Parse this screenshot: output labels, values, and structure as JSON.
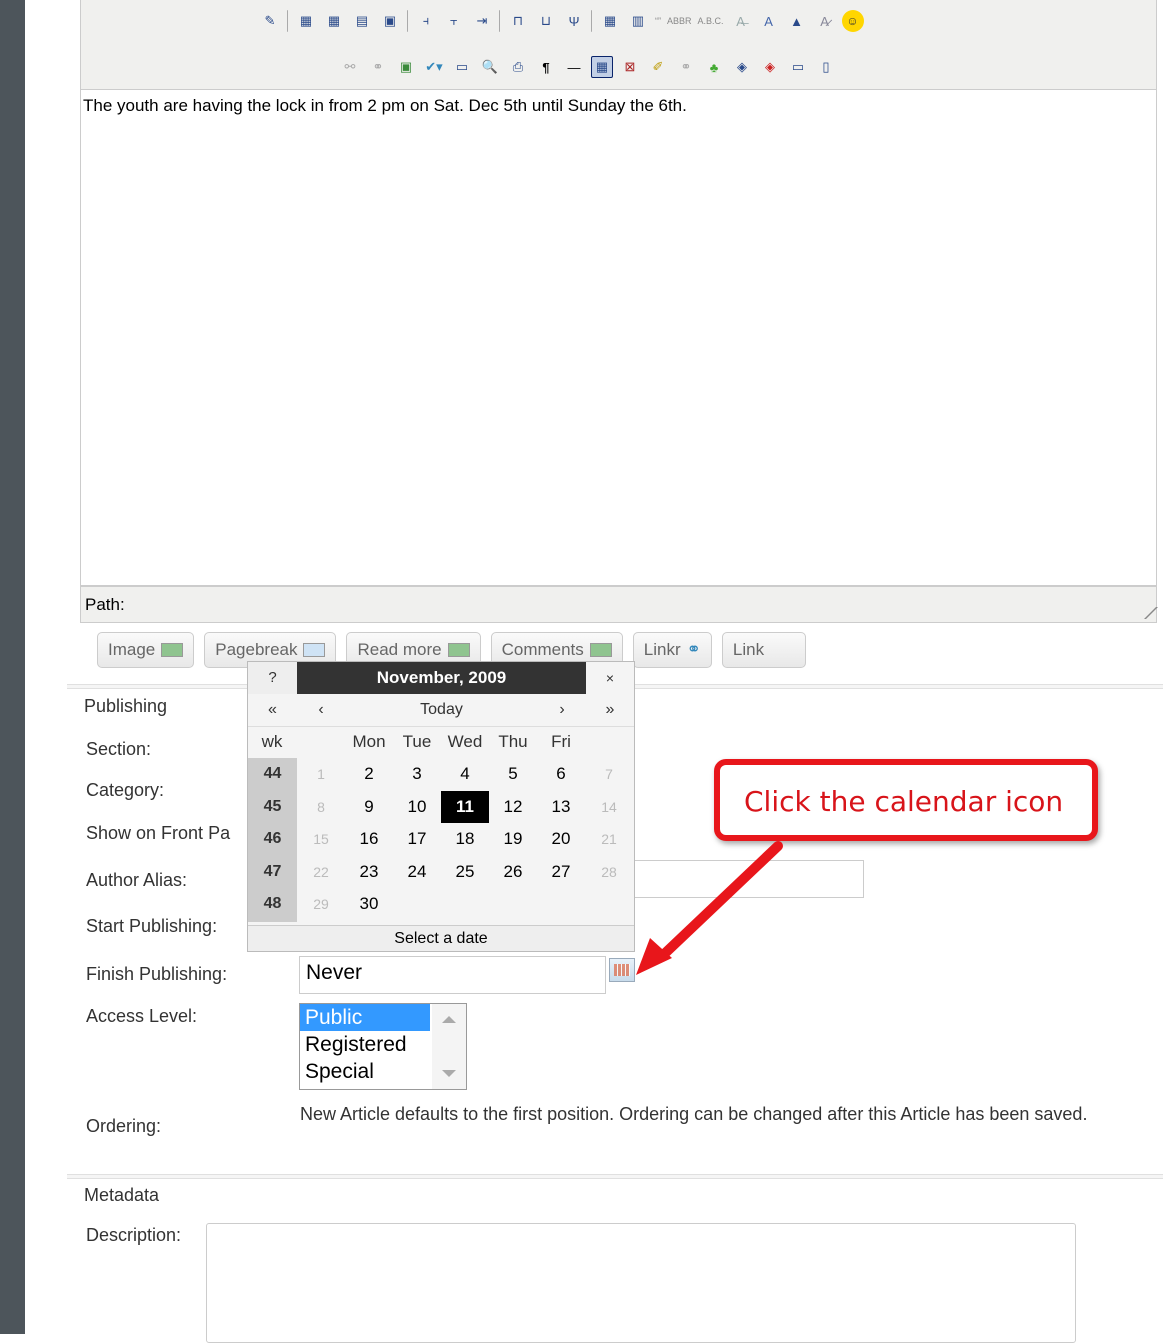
{
  "editor": {
    "content": "The youth are having the lock in from 2 pm on Sat. Dec 5th until Sunday the 6th.",
    "path_label": "Path:",
    "buttons": [
      "Image",
      "Pagebreak",
      "Read more",
      "Comments",
      "Linkr",
      "Link"
    ]
  },
  "publishing": {
    "legend": "Publishing",
    "labels": {
      "section": "Section:",
      "category": "Category:",
      "show_front": "Show on Front Pa",
      "author_alias": "Author Alias:",
      "start_publishing": "Start Publishing:",
      "finish_publishing": "Finish Publishing:",
      "access_level": "Access Level:",
      "ordering": "Ordering:"
    },
    "finish_value": "Never",
    "access_options": [
      "Public",
      "Registered",
      "Special"
    ],
    "access_selected": "Public",
    "ordering_text": "New Article defaults to the first position. Ordering can be changed after this Article has been saved."
  },
  "metadata": {
    "legend": "Metadata",
    "description_label": "Description:"
  },
  "calendar": {
    "help": "?",
    "title": "November, 2009",
    "close": "×",
    "prev_year": "«",
    "prev_month": "‹",
    "today": "Today",
    "next_month": "›",
    "next_year": "»",
    "wk_header": "wk",
    "day_headers": [
      "Mon",
      "Tue",
      "Wed",
      "Thu",
      "Fri"
    ],
    "weeks": [
      {
        "wk": "44",
        "days": [
          "1",
          "2",
          "3",
          "4",
          "5",
          "6",
          "7"
        ]
      },
      {
        "wk": "45",
        "days": [
          "8",
          "9",
          "10",
          "11",
          "12",
          "13",
          "14"
        ]
      },
      {
        "wk": "46",
        "days": [
          "15",
          "16",
          "17",
          "18",
          "19",
          "20",
          "21"
        ]
      },
      {
        "wk": "47",
        "days": [
          "22",
          "23",
          "24",
          "25",
          "26",
          "27",
          "28"
        ]
      },
      {
        "wk": "48",
        "days": [
          "29",
          "30"
        ]
      }
    ],
    "selected_day": "11",
    "footer": "Select a date"
  },
  "callout": {
    "text": "Click the calendar icon",
    "color": "#e8161b"
  },
  "toolbar_icons": {
    "row1": [
      "edit-icon",
      "sep",
      "insert-row-before-icon",
      "insert-row-after-icon",
      "delete-row-icon",
      "table-props-icon",
      "sep",
      "col-before-icon",
      "col-after-icon",
      "delete-col-icon",
      "sep",
      "split-cell-icon",
      "merge-cell-icon",
      "sep",
      "table-icon",
      "table-row-icon",
      "cite-icon",
      "abbr-icon",
      "acronym-icon",
      "strikethrough-icon",
      "underline-color-icon",
      "attributes-icon",
      "style-icon",
      "smiley-icon"
    ],
    "row2": [
      "unlink-icon",
      "link-icon",
      "image-icon",
      "spellcheck-icon",
      "media-icon",
      "preview-icon",
      "print-icon",
      "pilcrow-icon",
      "hr-icon",
      "visual-aid-icon",
      "template-icon",
      "cleanup-icon",
      "anchor-icon",
      "tree-icon",
      "code-icon",
      "html-icon",
      "layer-icon",
      "fullscreen-icon"
    ]
  }
}
